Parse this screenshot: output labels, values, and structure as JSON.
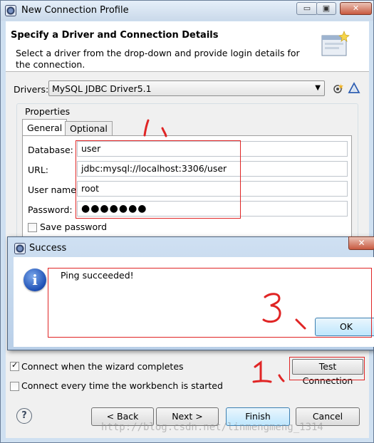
{
  "window": {
    "title": "New Connection Profile",
    "minimize_label": "▭",
    "maximize_label": "▣",
    "close_label": "✕"
  },
  "header": {
    "title": "Specify a Driver and Connection Details",
    "description": "Select a driver from the drop-down and provide login details for the connection."
  },
  "drivers": {
    "label": "Drivers:",
    "selected": "MySQL JDBC Driver5.1",
    "arrow": "▼"
  },
  "properties": {
    "label": "Properties",
    "tabs": [
      "General",
      "Optional"
    ],
    "fields": {
      "database_label": "Database:",
      "database_value": "user",
      "url_label": "URL:",
      "url_value": "jdbc:mysql://localhost:3306/user",
      "username_label": "User name:",
      "username_value": "root",
      "password_label": "Password:",
      "password_value": "●●●●●●●"
    },
    "save_password_label": "Save password"
  },
  "dialog": {
    "title": "Success",
    "close_label": "✕",
    "message": "Ping succeeded!",
    "ok_label": "OK",
    "info_glyph": "i"
  },
  "options": {
    "connect_on_finish_label": "Connect when the wizard completes",
    "connect_on_finish_checked": true,
    "connect_every_time_label": "Connect every time the workbench is started",
    "connect_every_time_checked": false,
    "test_connection_label": "Test Connection"
  },
  "buttons": {
    "back": "< Back",
    "next": "Next >",
    "finish": "Finish",
    "cancel": "Cancel",
    "help": "?"
  },
  "watermark": "http://blog.csdn.net/linmengmeng_1314",
  "colors": {
    "annotation_red": "#e02525",
    "window_frame": "#cfe0f1",
    "dialog_frame": "#b9cfe8"
  }
}
